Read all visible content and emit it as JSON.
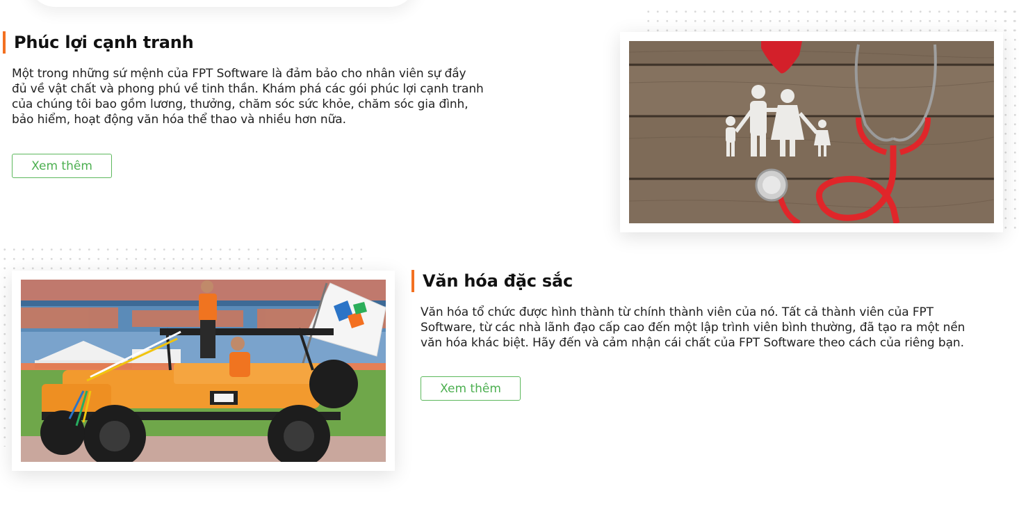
{
  "sections": [
    {
      "title": "Phúc lợi cạnh tranh",
      "description": "Một trong những sứ mệnh của FPT Software là đảm bảo cho nhân viên sự đầy đủ về vật chất và phong phú về tinh thần. Khám phá các gói phúc lợi cạnh tranh của chúng tôi bao gồm lương, thưởng, chăm sóc sức khỏe, chăm sóc gia đình, bảo hiểm, hoạt động văn hóa thể thao và nhiều hơn nữa.",
      "description_lines": [
        "Một trong những sứ mệnh của FPT Software là đảm bảo cho nhân viên sự đầy",
        "đủ về vật chất và phong phú về tinh thần. Khám phá các gói phúc lợi cạnh tranh",
        "của chúng tôi bao gồm lương, thưởng, chăm sóc sức khỏe, chăm sóc gia đình,",
        "bảo hiểm, hoạt động văn hóa thể thao và nhiều hơn nữa."
      ],
      "button_label": "Xem thêm",
      "image_icon": "family-stethoscope-photo"
    },
    {
      "title": "Văn hóa đặc sắc",
      "description_lines": [
        "Văn hóa tổ chức được hình thành từ chính thành viên của nó. Tất cả thành viên của FPT",
        "Software, từ các nhà lãnh đạo cấp cao đến một lập trình viên bình thường, đã tạo ra một nền",
        "văn hóa khác biệt. Hãy đến và cảm nhận cái chất của FPT Software theo cách của riêng bạn."
      ],
      "button_label": "Xem thêm",
      "image_icon": "jeep-parade-photo"
    }
  ],
  "colors": {
    "accent": "#f37021",
    "button_border": "#5cb85c",
    "button_text": "#4caf50"
  }
}
